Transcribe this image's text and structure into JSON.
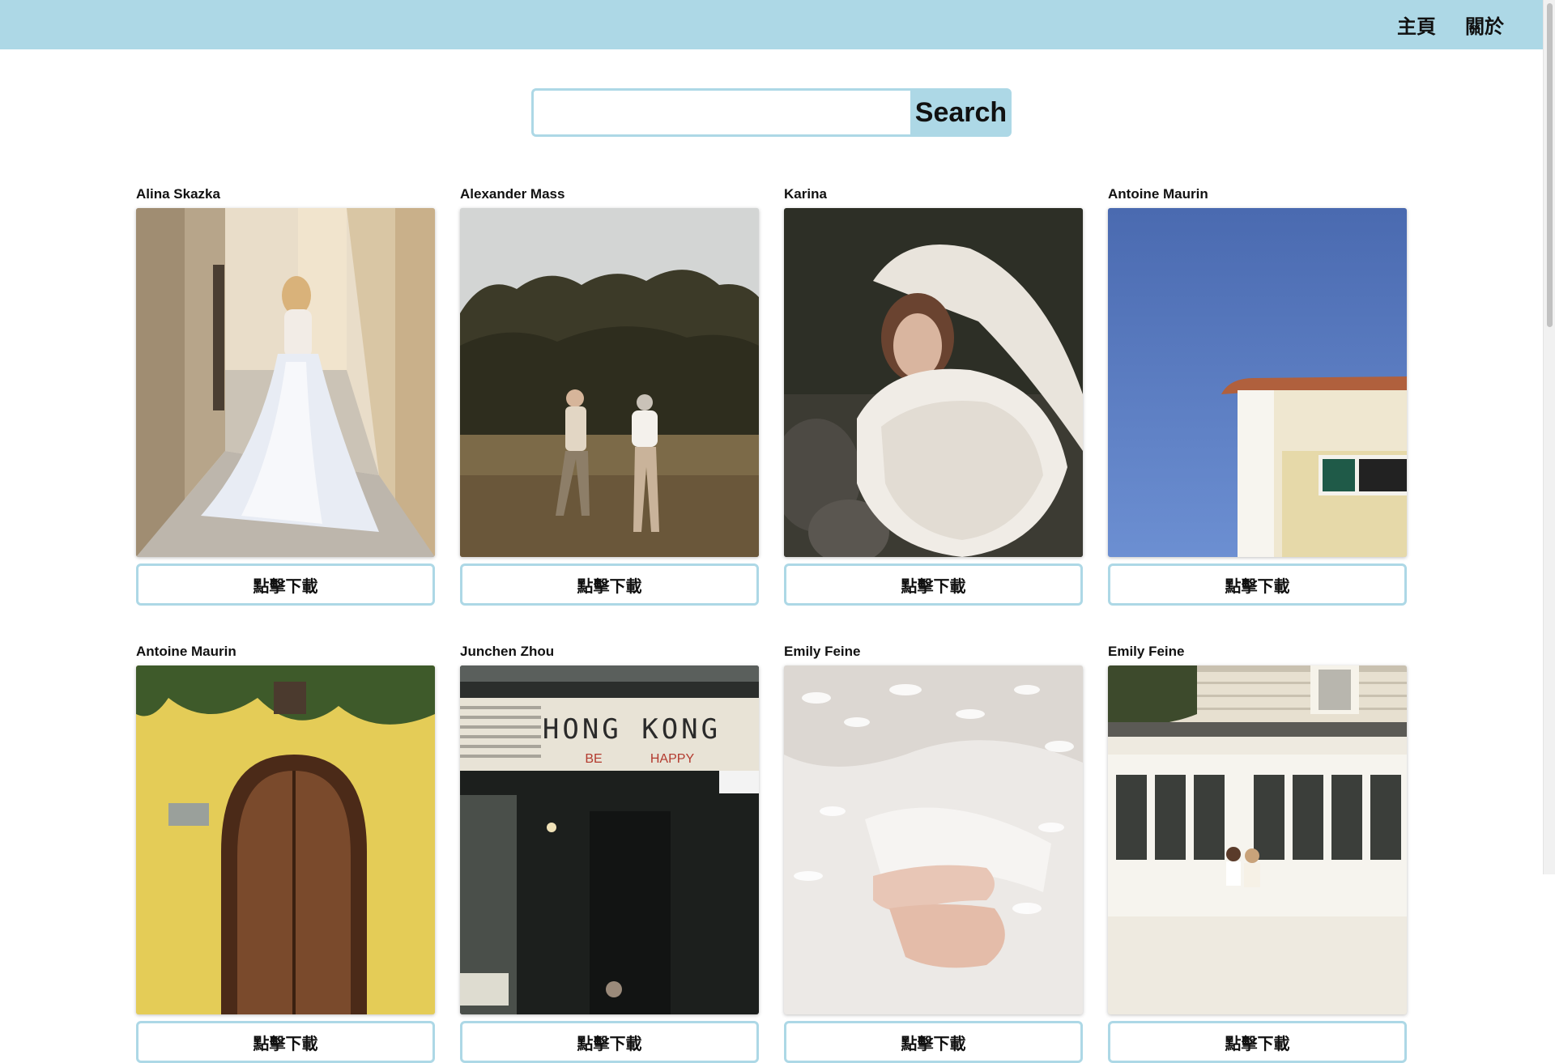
{
  "nav": {
    "home_label": "主頁",
    "about_label": "關於",
    "background": "#add8e6"
  },
  "search": {
    "value": "",
    "placeholder": "",
    "button_label": "Search"
  },
  "photos": [
    {
      "author": "Alina Skazka",
      "download_label": "點擊下載",
      "subject": "girl-in-white-dress-running-in-alley"
    },
    {
      "author": "Alexander Mass",
      "download_label": "點擊下載",
      "subject": "older-couple-walking-in-field"
    },
    {
      "author": "Karina",
      "download_label": "點擊下載",
      "subject": "woman-with-white-feather-wings"
    },
    {
      "author": "Antoine Maurin",
      "download_label": "點擊下載",
      "subject": "house-corner-against-blue-sky"
    },
    {
      "author": "Antoine Maurin",
      "download_label": "點擊下載",
      "subject": "arched-wooden-door-yellow-wall"
    },
    {
      "author": "Junchen Zhou",
      "download_label": "點擊下載",
      "subject": "hong-kong-storefront-sign"
    },
    {
      "author": "Emily Feine",
      "download_label": "點擊下載",
      "subject": "lace-sleeve-hands"
    },
    {
      "author": "Emily Feine",
      "download_label": "點擊下載",
      "subject": "house-windows-couple"
    }
  ],
  "sign_text": {
    "line1": "HONG KONG",
    "be": "BE",
    "happy": "HAPPY"
  }
}
